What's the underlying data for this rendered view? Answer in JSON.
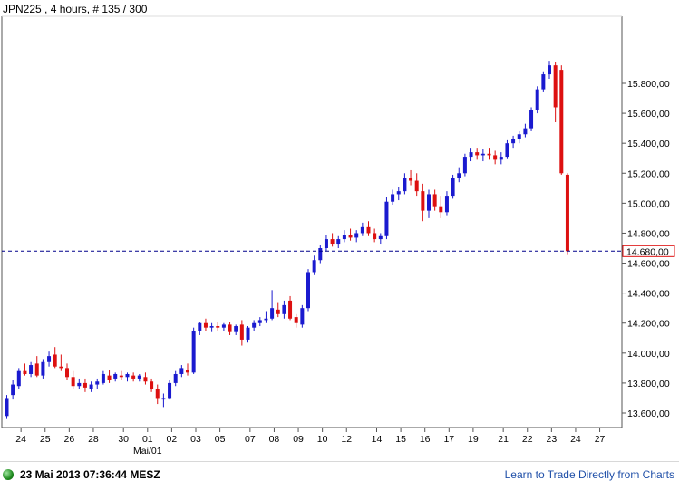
{
  "header": {
    "title": "JPN225 , 4 hours, # 135 / 300"
  },
  "footer": {
    "timestamp": "23 Mai 2013 07:36:44 MESZ",
    "promo_link": "Learn to Trade Directly from Charts"
  },
  "colors": {
    "up_candle": "#1a1acf",
    "down_candle": "#dd1010",
    "price_line": "#00008b",
    "price_marker_border": "#dd1010",
    "grid_border": "#555555"
  },
  "chart_data": {
    "type": "candlestick",
    "symbol": "JPN225",
    "timeframe": "4 hours",
    "ylim": [
      13550,
      15980
    ],
    "y_ticks": [
      "13.600,00",
      "13.800,00",
      "14.000,00",
      "14.200,00",
      "14.400,00",
      "14.600,00",
      "14.800,00",
      "15.000,00",
      "15.200,00",
      "15.400,00",
      "15.600,00",
      "15.800,00"
    ],
    "y_tick_values": [
      13600,
      13800,
      14000,
      14200,
      14400,
      14600,
      14800,
      15000,
      15200,
      15400,
      15600,
      15800
    ],
    "current_price": 14680,
    "current_price_label": "14.680,00",
    "x_ticks": [
      {
        "label": "24",
        "index": 1
      },
      {
        "label": "25",
        "index": 5
      },
      {
        "label": "26",
        "index": 9
      },
      {
        "label": "28",
        "index": 13
      },
      {
        "label": "30",
        "index": 18
      },
      {
        "label": "01",
        "index": 22
      },
      {
        "label": "02",
        "index": 26
      },
      {
        "label": "03",
        "index": 30
      },
      {
        "label": "05",
        "index": 34
      },
      {
        "label": "07",
        "index": 39
      },
      {
        "label": "08",
        "index": 43
      },
      {
        "label": "09",
        "index": 47
      },
      {
        "label": "10",
        "index": 51
      },
      {
        "label": "12",
        "index": 55
      },
      {
        "label": "14",
        "index": 60
      },
      {
        "label": "15",
        "index": 64
      },
      {
        "label": "16",
        "index": 68
      },
      {
        "label": "17",
        "index": 72
      },
      {
        "label": "19",
        "index": 76
      },
      {
        "label": "21",
        "index": 81
      },
      {
        "label": "22",
        "index": 85
      },
      {
        "label": "23",
        "index": 89
      },
      {
        "label": "24",
        "index": 93
      },
      {
        "label": "27",
        "index": 97
      }
    ],
    "x_sublabel": {
      "label": "Mai/01",
      "index": 22
    },
    "candles": [
      {
        "o": 13580,
        "h": 13720,
        "l": 13560,
        "c": 13700
      },
      {
        "o": 13720,
        "h": 13820,
        "l": 13690,
        "c": 13790
      },
      {
        "o": 13780,
        "h": 13900,
        "l": 13760,
        "c": 13880
      },
      {
        "o": 13880,
        "h": 13930,
        "l": 13850,
        "c": 13860
      },
      {
        "o": 13860,
        "h": 13940,
        "l": 13840,
        "c": 13920
      },
      {
        "o": 13930,
        "h": 13980,
        "l": 13840,
        "c": 13850
      },
      {
        "o": 13850,
        "h": 13960,
        "l": 13830,
        "c": 13940
      },
      {
        "o": 13940,
        "h": 14010,
        "l": 13910,
        "c": 13980
      },
      {
        "o": 13990,
        "h": 14040,
        "l": 13900,
        "c": 13910
      },
      {
        "o": 13910,
        "h": 13990,
        "l": 13880,
        "c": 13900
      },
      {
        "o": 13900,
        "h": 13930,
        "l": 13820,
        "c": 13840
      },
      {
        "o": 13840,
        "h": 13880,
        "l": 13760,
        "c": 13780
      },
      {
        "o": 13780,
        "h": 13830,
        "l": 13760,
        "c": 13800
      },
      {
        "o": 13800,
        "h": 13830,
        "l": 13740,
        "c": 13770
      },
      {
        "o": 13760,
        "h": 13810,
        "l": 13740,
        "c": 13790
      },
      {
        "o": 13790,
        "h": 13830,
        "l": 13760,
        "c": 13810
      },
      {
        "o": 13800,
        "h": 13880,
        "l": 13790,
        "c": 13860
      },
      {
        "o": 13850,
        "h": 13890,
        "l": 13800,
        "c": 13820
      },
      {
        "o": 13830,
        "h": 13870,
        "l": 13810,
        "c": 13860
      },
      {
        "o": 13850,
        "h": 13880,
        "l": 13820,
        "c": 13840
      },
      {
        "o": 13840,
        "h": 13870,
        "l": 13810,
        "c": 13860
      },
      {
        "o": 13850,
        "h": 13870,
        "l": 13810,
        "c": 13830
      },
      {
        "o": 13830,
        "h": 13860,
        "l": 13810,
        "c": 13850
      },
      {
        "o": 13840,
        "h": 13870,
        "l": 13790,
        "c": 13810
      },
      {
        "o": 13810,
        "h": 13830,
        "l": 13740,
        "c": 13760
      },
      {
        "o": 13760,
        "h": 13790,
        "l": 13660,
        "c": 13700
      },
      {
        "o": 13690,
        "h": 13730,
        "l": 13640,
        "c": 13700
      },
      {
        "o": 13700,
        "h": 13820,
        "l": 13690,
        "c": 13800
      },
      {
        "o": 13800,
        "h": 13880,
        "l": 13780,
        "c": 13860
      },
      {
        "o": 13860,
        "h": 13920,
        "l": 13840,
        "c": 13900
      },
      {
        "o": 13890,
        "h": 13930,
        "l": 13850,
        "c": 13870
      },
      {
        "o": 13870,
        "h": 14170,
        "l": 13860,
        "c": 14150
      },
      {
        "o": 14150,
        "h": 14210,
        "l": 14120,
        "c": 14200
      },
      {
        "o": 14200,
        "h": 14230,
        "l": 14150,
        "c": 14170
      },
      {
        "o": 14170,
        "h": 14200,
        "l": 14140,
        "c": 14180
      },
      {
        "o": 14180,
        "h": 14210,
        "l": 14150,
        "c": 14170
      },
      {
        "o": 14170,
        "h": 14200,
        "l": 14150,
        "c": 14190
      },
      {
        "o": 14190,
        "h": 14210,
        "l": 14120,
        "c": 14140
      },
      {
        "o": 14140,
        "h": 14190,
        "l": 14120,
        "c": 14180
      },
      {
        "o": 14190,
        "h": 14220,
        "l": 14050,
        "c": 14090
      },
      {
        "o": 14090,
        "h": 14180,
        "l": 14070,
        "c": 14170
      },
      {
        "o": 14170,
        "h": 14220,
        "l": 14150,
        "c": 14200
      },
      {
        "o": 14200,
        "h": 14240,
        "l": 14180,
        "c": 14220
      },
      {
        "o": 14220,
        "h": 14280,
        "l": 14200,
        "c": 14230
      },
      {
        "o": 14230,
        "h": 14420,
        "l": 14220,
        "c": 14300
      },
      {
        "o": 14290,
        "h": 14340,
        "l": 14240,
        "c": 14260
      },
      {
        "o": 14260,
        "h": 14350,
        "l": 14230,
        "c": 14320
      },
      {
        "o": 14350,
        "h": 14380,
        "l": 14220,
        "c": 14230
      },
      {
        "o": 14240,
        "h": 14260,
        "l": 14170,
        "c": 14200
      },
      {
        "o": 14190,
        "h": 14320,
        "l": 14170,
        "c": 14300
      },
      {
        "o": 14300,
        "h": 14560,
        "l": 14280,
        "c": 14540
      },
      {
        "o": 14540,
        "h": 14650,
        "l": 14520,
        "c": 14620
      },
      {
        "o": 14620,
        "h": 14720,
        "l": 14600,
        "c": 14700
      },
      {
        "o": 14700,
        "h": 14790,
        "l": 14680,
        "c": 14760
      },
      {
        "o": 14760,
        "h": 14800,
        "l": 14710,
        "c": 14730
      },
      {
        "o": 14730,
        "h": 14780,
        "l": 14700,
        "c": 14760
      },
      {
        "o": 14760,
        "h": 14820,
        "l": 14740,
        "c": 14790
      },
      {
        "o": 14790,
        "h": 14830,
        "l": 14750,
        "c": 14770
      },
      {
        "o": 14770,
        "h": 14820,
        "l": 14740,
        "c": 14800
      },
      {
        "o": 14800,
        "h": 14870,
        "l": 14780,
        "c": 14840
      },
      {
        "o": 14840,
        "h": 14880,
        "l": 14780,
        "c": 14800
      },
      {
        "o": 14800,
        "h": 14830,
        "l": 14740,
        "c": 14760
      },
      {
        "o": 14760,
        "h": 14800,
        "l": 14730,
        "c": 14780
      },
      {
        "o": 14780,
        "h": 15040,
        "l": 14760,
        "c": 15010
      },
      {
        "o": 15010,
        "h": 15090,
        "l": 14990,
        "c": 15060
      },
      {
        "o": 15060,
        "h": 15110,
        "l": 15020,
        "c": 15080
      },
      {
        "o": 15080,
        "h": 15200,
        "l": 15060,
        "c": 15170
      },
      {
        "o": 15170,
        "h": 15220,
        "l": 15120,
        "c": 15150
      },
      {
        "o": 15150,
        "h": 15200,
        "l": 15050,
        "c": 15080
      },
      {
        "o": 15080,
        "h": 15130,
        "l": 14880,
        "c": 14950
      },
      {
        "o": 14950,
        "h": 15090,
        "l": 14900,
        "c": 15060
      },
      {
        "o": 15060,
        "h": 15090,
        "l": 14950,
        "c": 14980
      },
      {
        "o": 14980,
        "h": 15050,
        "l": 14900,
        "c": 14940
      },
      {
        "o": 14940,
        "h": 15080,
        "l": 14920,
        "c": 15050
      },
      {
        "o": 15050,
        "h": 15190,
        "l": 15030,
        "c": 15170
      },
      {
        "o": 15170,
        "h": 15240,
        "l": 15140,
        "c": 15200
      },
      {
        "o": 15200,
        "h": 15330,
        "l": 15180,
        "c": 15310
      },
      {
        "o": 15310,
        "h": 15370,
        "l": 15280,
        "c": 15340
      },
      {
        "o": 15340,
        "h": 15370,
        "l": 15290,
        "c": 15320
      },
      {
        "o": 15320,
        "h": 15360,
        "l": 15280,
        "c": 15330
      },
      {
        "o": 15330,
        "h": 15370,
        "l": 15290,
        "c": 15320
      },
      {
        "o": 15320,
        "h": 15350,
        "l": 15260,
        "c": 15290
      },
      {
        "o": 15290,
        "h": 15340,
        "l": 15260,
        "c": 15310
      },
      {
        "o": 15310,
        "h": 15420,
        "l": 15300,
        "c": 15400
      },
      {
        "o": 15400,
        "h": 15450,
        "l": 15370,
        "c": 15430
      },
      {
        "o": 15430,
        "h": 15480,
        "l": 15400,
        "c": 15460
      },
      {
        "o": 15460,
        "h": 15530,
        "l": 15440,
        "c": 15500
      },
      {
        "o": 15500,
        "h": 15640,
        "l": 15480,
        "c": 15620
      },
      {
        "o": 15620,
        "h": 15780,
        "l": 15600,
        "c": 15760
      },
      {
        "o": 15760,
        "h": 15880,
        "l": 15740,
        "c": 15860
      },
      {
        "o": 15860,
        "h": 15950,
        "l": 15830,
        "c": 15920
      },
      {
        "o": 15920,
        "h": 15940,
        "l": 15540,
        "c": 15640
      },
      {
        "o": 15890,
        "h": 15920,
        "l": 15190,
        "c": 15200
      },
      {
        "o": 15190,
        "h": 15200,
        "l": 14660,
        "c": 14680
      }
    ]
  }
}
